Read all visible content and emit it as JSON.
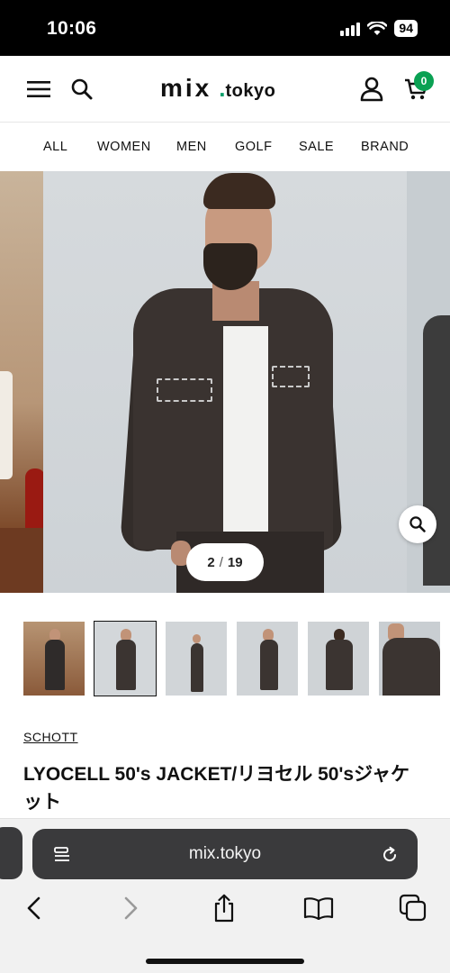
{
  "status_bar": {
    "time": "10:06",
    "battery": "94"
  },
  "header": {
    "logo_main": "mix",
    "logo_sub": "tokyo",
    "logo_dot": ".",
    "cart_count": "0",
    "icons": [
      "menu-icon",
      "search-icon",
      "user-icon",
      "cart-icon"
    ]
  },
  "categories": [
    "ALL",
    "WOMEN",
    "MEN",
    "GOLF",
    "SALE",
    "BRAND"
  ],
  "gallery": {
    "current": "2",
    "separator": "/",
    "total": "19",
    "active_thumb": 2,
    "thumb_count": 6
  },
  "product": {
    "brand": "SCHOTT",
    "title": "LYOCELL 50's JACKET/リヨセル 50'sジャケット"
  },
  "browser": {
    "url": "mix.tokyo",
    "toolbar_icons": [
      "back-icon",
      "forward-icon",
      "share-icon",
      "bookmarks-icon",
      "tabs-icon"
    ]
  },
  "colors": {
    "accent_green": "#0aa153",
    "url_bar": "#3a3a3c"
  }
}
